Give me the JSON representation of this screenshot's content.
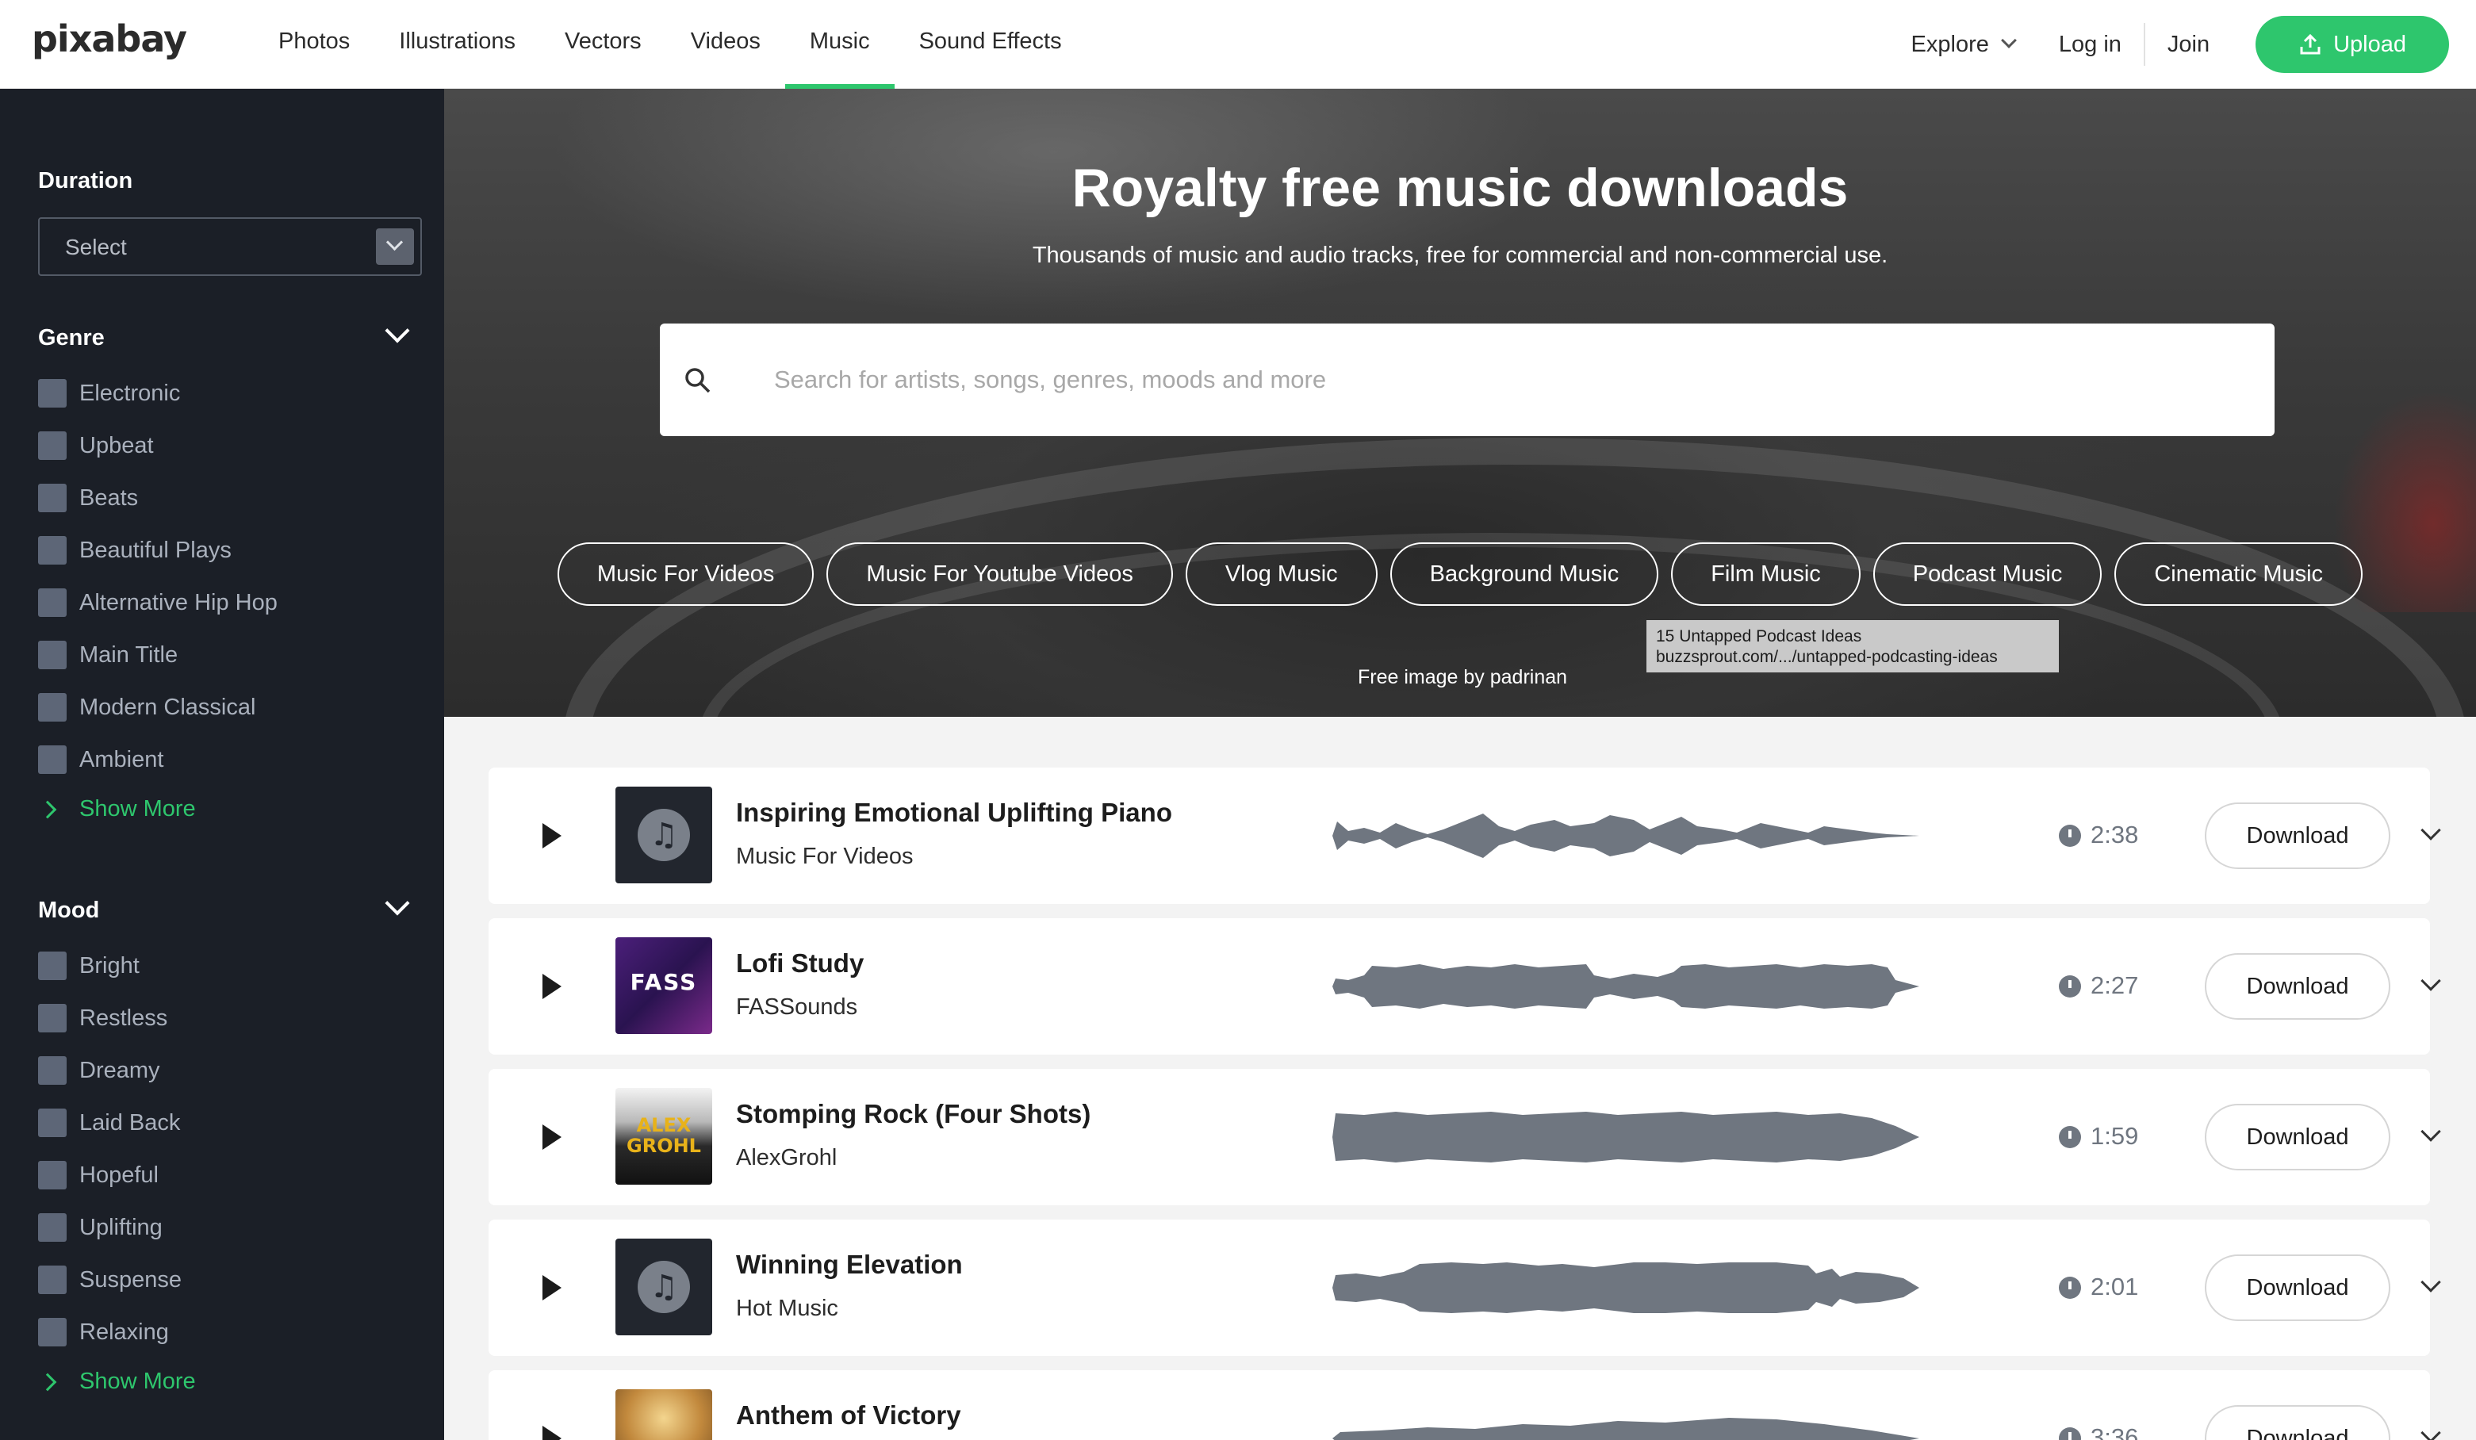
{
  "header": {
    "logo": "pixabay",
    "nav": [
      "Photos",
      "Illustrations",
      "Vectors",
      "Videos",
      "Music",
      "Sound Effects"
    ],
    "active_nav": "Music",
    "explore": "Explore",
    "login": "Log in",
    "join": "Join",
    "upload": "Upload"
  },
  "sidebar": {
    "duration": {
      "title": "Duration",
      "select": "Select"
    },
    "genre": {
      "title": "Genre",
      "items": [
        "Electronic",
        "Upbeat",
        "Beats",
        "Beautiful Plays",
        "Alternative Hip Hop",
        "Main Title",
        "Modern Classical",
        "Ambient"
      ],
      "show_more": "Show More"
    },
    "mood": {
      "title": "Mood",
      "items": [
        "Bright",
        "Restless",
        "Dreamy",
        "Laid Back",
        "Hopeful",
        "Uplifting",
        "Suspense",
        "Relaxing"
      ],
      "show_more": "Show More"
    }
  },
  "hero": {
    "title": "Royalty free music downloads",
    "subtitle": "Thousands of music and audio tracks, free for commercial and non-commercial use.",
    "search_placeholder": "Search for artists, songs, genres, moods and more",
    "chips": [
      "Music For Videos",
      "Music For Youtube Videos",
      "Vlog Music",
      "Background Music",
      "Film Music",
      "Podcast Music",
      "Cinematic Music"
    ],
    "tooltip": {
      "line1": "15 Untapped Podcast Ideas",
      "line2": "buzzsprout.com/.../untapped-podcasting-ideas"
    },
    "credit": "Free image by padrinan"
  },
  "tracks": [
    {
      "title": "Inspiring Emotional Uplifting Piano",
      "artist": "Music For Videos",
      "duration": "2:38",
      "download": "Download",
      "thumb_icon": "music-note-icon"
    },
    {
      "title": "Lofi Study",
      "artist": "FASSounds",
      "duration": "2:27",
      "download": "Download",
      "thumb_text": "FASS"
    },
    {
      "title": "Stomping Rock (Four Shots)",
      "artist": "AlexGrohl",
      "duration": "1:59",
      "download": "Download",
      "thumb_text": "ALEX GROHL"
    },
    {
      "title": "Winning Elevation",
      "artist": "Hot Music",
      "duration": "2:01",
      "download": "Download",
      "thumb_icon": "music-note-icon"
    },
    {
      "title": "Anthem of Victory",
      "artist": "",
      "duration": "3:36",
      "download": "Download",
      "thumb_icon": "album-cover-image"
    }
  ],
  "colors": {
    "accent": "#2ec66d",
    "sidebar_bg": "#1b1f27",
    "waveform": "#6f7680"
  }
}
